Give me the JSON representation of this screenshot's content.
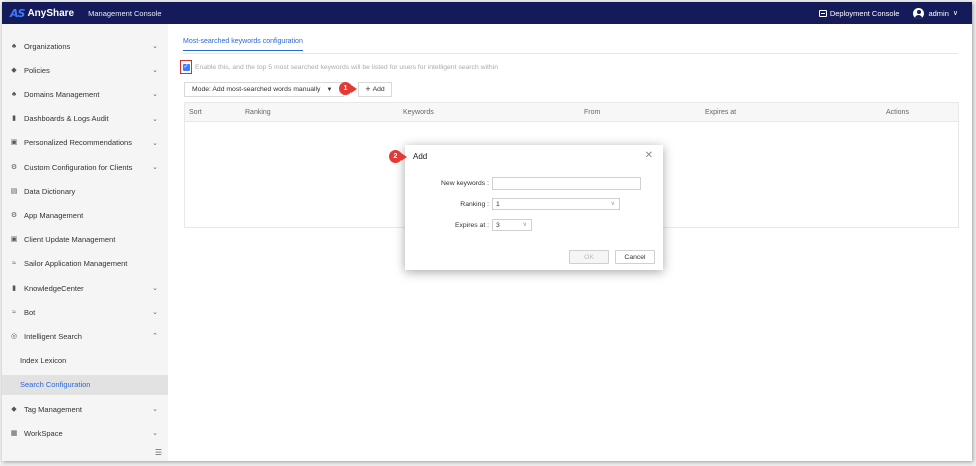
{
  "topbar": {
    "logo_mark": "AS",
    "logo_text": "AnyShare",
    "console_title": "Management Console",
    "deploy_label": "Deployment Console",
    "user_label": "admin"
  },
  "sidebar": {
    "items": [
      {
        "label": "Organizations",
        "icon": "org-icon",
        "chevron": "down"
      },
      {
        "label": "Policies",
        "icon": "shield-icon",
        "chevron": "down"
      },
      {
        "label": "Domains Management",
        "icon": "domain-icon",
        "chevron": "down"
      },
      {
        "label": "Dashboards & Logs Audit",
        "icon": "chart-icon",
        "chevron": "down"
      },
      {
        "label": "Personalized Recommendations",
        "icon": "recommend-icon",
        "chevron": "down"
      },
      {
        "label": "Custom Configuration for Clients",
        "icon": "settings-icon",
        "chevron": "down"
      },
      {
        "label": "Data Dictionary",
        "icon": "book-icon",
        "chevron": ""
      },
      {
        "label": "App Management",
        "icon": "gear-icon",
        "chevron": ""
      },
      {
        "label": "Client Update Management",
        "icon": "update-icon",
        "chevron": ""
      },
      {
        "label": "Sailor Application Management",
        "icon": "sailor-icon",
        "chevron": ""
      },
      {
        "label": "KnowledgeCenter",
        "icon": "knowledge-icon",
        "chevron": "down"
      },
      {
        "label": "Bot",
        "icon": "bot-icon",
        "chevron": "down"
      },
      {
        "label": "Intelligent Search",
        "icon": "search-icon",
        "chevron": "up"
      },
      {
        "label": "Index Lexicon",
        "icon": "",
        "chevron": "",
        "sub": true
      },
      {
        "label": "Search Configuration",
        "icon": "",
        "chevron": "",
        "sub": true,
        "active": true
      },
      {
        "label": "Tag Management",
        "icon": "tag-icon",
        "chevron": "down"
      },
      {
        "label": "WorkSpace",
        "icon": "workspace-icon",
        "chevron": "down"
      }
    ]
  },
  "main": {
    "tab_label": "Most-searched keywords configuration",
    "enable_text": "Enable this, and the top 5 most searched keywords will be listed for users for intelligent search within",
    "mode_label": "Mode:  Add most-searched words manually",
    "add_label": "Add",
    "badge1": "1",
    "table_headers": [
      "Sort",
      "Ranking",
      "Keywords",
      "From",
      "Expires at",
      "Actions"
    ]
  },
  "modal": {
    "badge2": "2",
    "title": "Add",
    "keywords_label": "New keywords :",
    "keywords_value": "",
    "ranking_label": "Ranking :",
    "ranking_value": "1",
    "expires_label": "Expires at :",
    "expires_value": "3",
    "ok_label": "OK",
    "cancel_label": "Cancel"
  },
  "colors": {
    "topbar": "#141a5a",
    "accent": "#2a67d9",
    "annotation_red": "#e53935"
  }
}
